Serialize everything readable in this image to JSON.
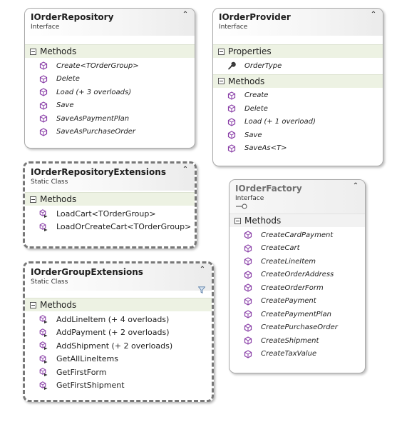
{
  "colors": {
    "method_icon": "#8a3fa8",
    "section_bg": "#edf2e3",
    "dashed_border": "#787878",
    "box_border": "#a8a8a8"
  },
  "boxes": [
    {
      "title": "IOrderRepository",
      "subtitle": "Interface",
      "sections": [
        {
          "label": "Methods",
          "items": [
            {
              "label": "Create<TOrderGroup>",
              "icon": "method-icon"
            },
            {
              "label": "Delete",
              "icon": "method-icon"
            },
            {
              "label": "Load (+ 3 overloads)",
              "icon": "method-icon"
            },
            {
              "label": "Save",
              "icon": "method-icon"
            },
            {
              "label": "SaveAsPaymentPlan",
              "icon": "method-icon"
            },
            {
              "label": "SaveAsPurchaseOrder",
              "icon": "method-icon"
            }
          ]
        }
      ]
    },
    {
      "title": "IOrderProvider",
      "subtitle": "Interface",
      "sections": [
        {
          "label": "Properties",
          "items": [
            {
              "label": "OrderType",
              "icon": "wrench-property-icon"
            }
          ]
        },
        {
          "label": "Methods",
          "items": [
            {
              "label": "Create",
              "icon": "method-icon"
            },
            {
              "label": "Delete",
              "icon": "method-icon"
            },
            {
              "label": "Load (+ 1 overload)",
              "icon": "method-icon"
            },
            {
              "label": "Save",
              "icon": "method-icon"
            },
            {
              "label": "SaveAs<T>",
              "icon": "method-icon"
            }
          ]
        }
      ]
    },
    {
      "title": "IOrderRepositoryExtensions",
      "subtitle": "Static Class",
      "sections": [
        {
          "label": "Methods",
          "items": [
            {
              "label": "LoadCart<TOrderGroup>",
              "icon": "extension-method-icon"
            },
            {
              "label": "LoadOrCreateCart<TOrderGroup>",
              "icon": "extension-method-icon"
            }
          ]
        }
      ]
    },
    {
      "title": "IOrderFactory",
      "subtitle": "Interface",
      "sections": [
        {
          "label": "Methods",
          "items": [
            {
              "label": "CreateCardPayment",
              "icon": "method-icon"
            },
            {
              "label": "CreateCart",
              "icon": "method-icon"
            },
            {
              "label": "CreateLineItem",
              "icon": "method-icon"
            },
            {
              "label": "CreateOrderAddress",
              "icon": "method-icon"
            },
            {
              "label": "CreateOrderForm",
              "icon": "method-icon"
            },
            {
              "label": "CreatePayment",
              "icon": "method-icon"
            },
            {
              "label": "CreatePaymentPlan",
              "icon": "method-icon"
            },
            {
              "label": "CreatePurchaseOrder",
              "icon": "method-icon"
            },
            {
              "label": "CreateShipment",
              "icon": "method-icon"
            },
            {
              "label": "CreateTaxValue",
              "icon": "method-icon"
            }
          ]
        }
      ]
    },
    {
      "title": "IOrderGroupExtensions",
      "subtitle": "Static Class",
      "sections": [
        {
          "label": "Methods",
          "items": [
            {
              "label": "AddLineItem (+ 4 overloads)",
              "icon": "extension-method-icon"
            },
            {
              "label": "AddPayment (+ 2 overloads)",
              "icon": "extension-method-icon"
            },
            {
              "label": "AddShipment (+ 2 overloads)",
              "icon": "extension-method-icon"
            },
            {
              "label": "GetAllLineItems",
              "icon": "extension-method-icon"
            },
            {
              "label": "GetFirstForm",
              "icon": "extension-method-icon"
            },
            {
              "label": "GetFirstShipment",
              "icon": "extension-method-icon"
            }
          ]
        }
      ]
    }
  ]
}
